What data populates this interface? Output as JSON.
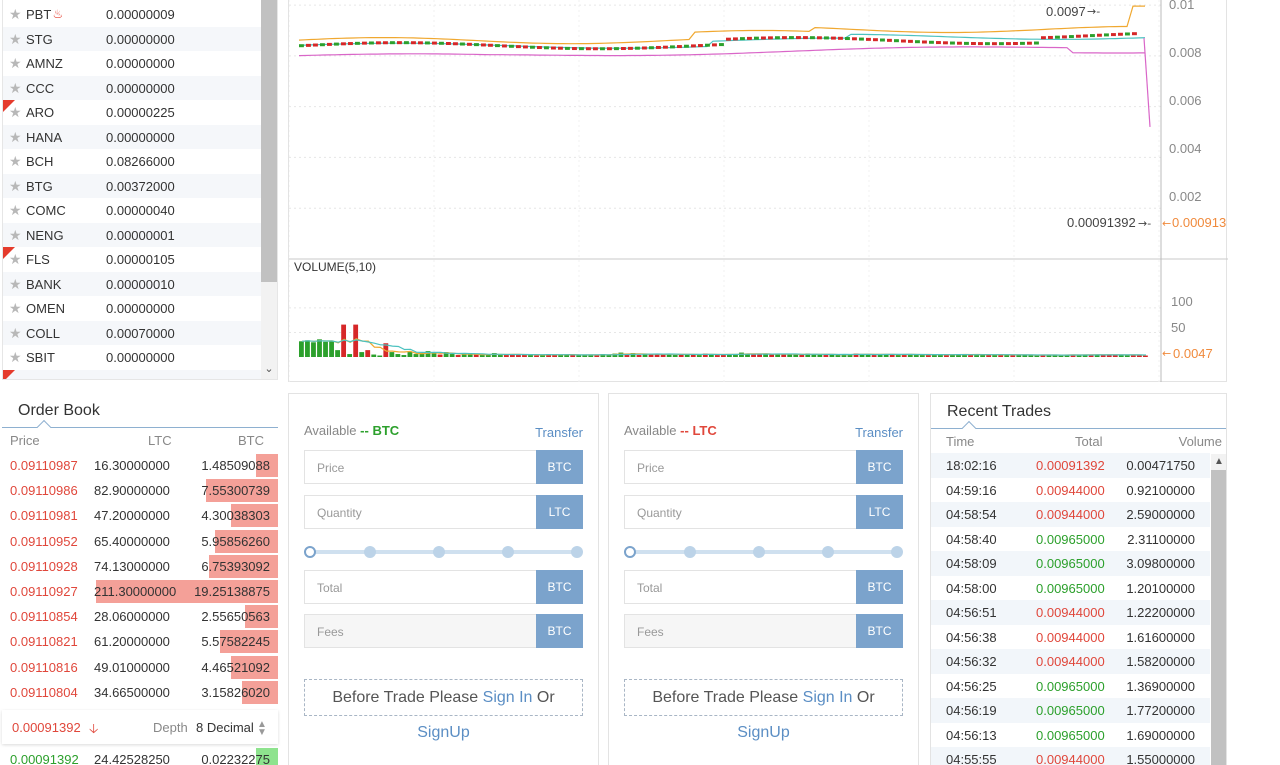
{
  "market": {
    "rows": [
      {
        "symbol": "PBT",
        "price": "0.00000009",
        "hot": true,
        "is_new": false
      },
      {
        "symbol": "STG",
        "price": "0.00000000",
        "hot": false,
        "is_new": false
      },
      {
        "symbol": "AMNZ",
        "price": "0.00000000",
        "hot": false,
        "is_new": false
      },
      {
        "symbol": "CCC",
        "price": "0.00000000",
        "hot": false,
        "is_new": false
      },
      {
        "symbol": "ARO",
        "price": "0.00000225",
        "hot": false,
        "is_new": true
      },
      {
        "symbol": "HANA",
        "price": "0.00000000",
        "hot": false,
        "is_new": false
      },
      {
        "symbol": "BCH",
        "price": "0.08266000",
        "hot": false,
        "is_new": false
      },
      {
        "symbol": "BTG",
        "price": "0.00372000",
        "hot": false,
        "is_new": false
      },
      {
        "symbol": "COMC",
        "price": "0.00000040",
        "hot": false,
        "is_new": false
      },
      {
        "symbol": "NENG",
        "price": "0.00000001",
        "hot": false,
        "is_new": false
      },
      {
        "symbol": "FLS",
        "price": "0.00000105",
        "hot": false,
        "is_new": true
      },
      {
        "symbol": "BANK",
        "price": "0.00000010",
        "hot": false,
        "is_new": false
      },
      {
        "symbol": "OMEN",
        "price": "0.00000000",
        "hot": false,
        "is_new": false
      },
      {
        "symbol": "COLL",
        "price": "0.00070000",
        "hot": false,
        "is_new": false
      },
      {
        "symbol": "SBIT",
        "price": "0.00000000",
        "hot": false,
        "is_new": false
      },
      {
        "symbol": "",
        "price": "",
        "hot": false,
        "is_new": true
      }
    ]
  },
  "chart": {
    "price_axis": [
      "0.01",
      "0.008",
      "0.006",
      "0.004",
      "0.002"
    ],
    "price_ylim": [
      0,
      0.0102
    ],
    "high_marker": "0.0097",
    "last_price_label": "0.00091392",
    "last_price_axis": "0.000913",
    "volume_title": "VOLUME(5,10)",
    "volume_axis": [
      "100",
      "50"
    ],
    "volume_ylim": [
      0,
      165
    ],
    "volume_last_axis": "0.0047",
    "colors": {
      "up": "#2ca02c",
      "down": "#d62728",
      "ma_orange": "#f0a830",
      "ma_teal": "#4cc2c0",
      "ma_pink": "#d966c8",
      "axis_orange": "#f08a3c"
    },
    "volumes": [
      32,
      34,
      30,
      36,
      31,
      33,
      14,
      66,
      6,
      66,
      10,
      14,
      5,
      3,
      28,
      10,
      6,
      4,
      10,
      6,
      8,
      12,
      7,
      5,
      10,
      6,
      4,
      5,
      6,
      5,
      4,
      4,
      8,
      4,
      5,
      6,
      4,
      5,
      4,
      3,
      4,
      6,
      5,
      4,
      5,
      4,
      3,
      4,
      5,
      4,
      6,
      4,
      7,
      9,
      5,
      8,
      4,
      5,
      7,
      6,
      5,
      6,
      4,
      5,
      6,
      5,
      4,
      7,
      5,
      4,
      5,
      6,
      5,
      9,
      7,
      5,
      6,
      7,
      5,
      6,
      5,
      6,
      5,
      4,
      7,
      6,
      5,
      4,
      5,
      4,
      6,
      5,
      7,
      5,
      6,
      4,
      5,
      6,
      5,
      4,
      5,
      6,
      5,
      4,
      5,
      4,
      5,
      4,
      5,
      6,
      5,
      4,
      5,
      4,
      5,
      4,
      5,
      4,
      3,
      5,
      4,
      4,
      3,
      4,
      5,
      4,
      3,
      4,
      5,
      4,
      5,
      4,
      5,
      4,
      5,
      4,
      3,
      4,
      5,
      4,
      3
    ],
    "volume_up": [
      1,
      1,
      1,
      1,
      1,
      1,
      1,
      0,
      1,
      0,
      1,
      0,
      1,
      1,
      0,
      1,
      1,
      1,
      1,
      1,
      1,
      1,
      1,
      0,
      1,
      1,
      0,
      1,
      1,
      0,
      1,
      1,
      1,
      1,
      0,
      0,
      0,
      0,
      1,
      0,
      1,
      0,
      0,
      1,
      1,
      0,
      1,
      1,
      1,
      0,
      1,
      1,
      1,
      1,
      0,
      1,
      0,
      1,
      0,
      0,
      0,
      1,
      1,
      0,
      1,
      0,
      1,
      0,
      1,
      0,
      0,
      1,
      1,
      1,
      1,
      0,
      0,
      1,
      0,
      1,
      0,
      1,
      1,
      0,
      1,
      1,
      1,
      0,
      1,
      1,
      1,
      1,
      0,
      1,
      1,
      0,
      1,
      1,
      0,
      1,
      0,
      1,
      1,
      1,
      0,
      1,
      1,
      0,
      1,
      1,
      1,
      0,
      1,
      1,
      0,
      1,
      0,
      1,
      0,
      1,
      1,
      1,
      1,
      0,
      1,
      1,
      1,
      1,
      0,
      1,
      1,
      0,
      1,
      0,
      0,
      0,
      1,
      1,
      0,
      0
    ]
  },
  "orderbook": {
    "title": "Order Book",
    "col_price": "Price",
    "col_qty": "LTC",
    "col_total": "BTC",
    "asks": [
      {
        "price": "0.09110987",
        "qty": "16.30000000",
        "total": "1.48509088",
        "depth": 0.08
      },
      {
        "price": "0.09110986",
        "qty": "82.90000000",
        "total": "7.55300739",
        "depth": 0.26
      },
      {
        "price": "0.09110981",
        "qty": "47.20000000",
        "total": "4.30038303",
        "depth": 0.17
      },
      {
        "price": "0.09110952",
        "qty": "65.40000000",
        "total": "5.95856260",
        "depth": 0.23
      },
      {
        "price": "0.09110928",
        "qty": "74.13000000",
        "total": "6.75393092",
        "depth": 0.25
      },
      {
        "price": "0.09110927",
        "qty": "211.30000000",
        "total": "19.25138875",
        "depth": 0.66
      },
      {
        "price": "0.09110854",
        "qty": "28.06000000",
        "total": "2.55650563",
        "depth": 0.12
      },
      {
        "price": "0.09110821",
        "qty": "61.20000000",
        "total": "5.57582245",
        "depth": 0.21
      },
      {
        "price": "0.09110816",
        "qty": "49.01000000",
        "total": "4.46521092",
        "depth": 0.17
      },
      {
        "price": "0.09110804",
        "qty": "34.66500000",
        "total": "3.15826020",
        "depth": 0.13
      }
    ],
    "last_price": "0.00091392",
    "depth_label": "Depth",
    "decimal_select": "8 Decimal",
    "bid": {
      "price": "0.00091392",
      "qty": "24.42528250",
      "total": "0.02232275",
      "depth": 0.08
    }
  },
  "buy_form": {
    "available_label": "Available",
    "available_sep": "--",
    "available_currency": "BTC",
    "transfer": "Transfer",
    "price_placeholder": "Price",
    "price_unit": "BTC",
    "qty_placeholder": "Quantity",
    "qty_unit": "LTC",
    "total_placeholder": "Total",
    "total_unit": "BTC",
    "fees_placeholder": "Fees",
    "fees_unit": "BTC",
    "notice_prefix": "Before Trade Please",
    "sign_in": "Sign In",
    "or": "Or",
    "sign_up": "SignUp"
  },
  "sell_form": {
    "available_label": "Available",
    "available_sep": "--",
    "available_currency": "LTC",
    "transfer": "Transfer",
    "price_placeholder": "Price",
    "price_unit": "BTC",
    "qty_placeholder": "Quantity",
    "qty_unit": "LTC",
    "total_placeholder": "Total",
    "total_unit": "BTC",
    "fees_placeholder": "Fees",
    "fees_unit": "BTC",
    "notice_prefix": "Before Trade Please",
    "sign_in": "Sign In",
    "or": "Or",
    "sign_up": "SignUp"
  },
  "trades": {
    "title": "Recent Trades",
    "col_time": "Time",
    "col_total": "Total",
    "col_volume": "Volume",
    "rows": [
      {
        "time": "18:02:16",
        "price": "0.00091392",
        "volume": "0.00471750",
        "side": "sell"
      },
      {
        "time": "04:59:16",
        "price": "0.00944000",
        "volume": "0.92100000",
        "side": "sell"
      },
      {
        "time": "04:58:54",
        "price": "0.00944000",
        "volume": "2.59000000",
        "side": "sell"
      },
      {
        "time": "04:58:40",
        "price": "0.00965000",
        "volume": "2.31100000",
        "side": "buy"
      },
      {
        "time": "04:58:09",
        "price": "0.00965000",
        "volume": "3.09800000",
        "side": "buy"
      },
      {
        "time": "04:58:00",
        "price": "0.00965000",
        "volume": "1.20100000",
        "side": "buy"
      },
      {
        "time": "04:56:51",
        "price": "0.00944000",
        "volume": "1.22200000",
        "side": "sell"
      },
      {
        "time": "04:56:38",
        "price": "0.00944000",
        "volume": "1.61600000",
        "side": "sell"
      },
      {
        "time": "04:56:32",
        "price": "0.00944000",
        "volume": "1.58200000",
        "side": "sell"
      },
      {
        "time": "04:56:25",
        "price": "0.00965000",
        "volume": "1.36900000",
        "side": "buy"
      },
      {
        "time": "04:56:19",
        "price": "0.00965000",
        "volume": "1.77200000",
        "side": "buy"
      },
      {
        "time": "04:56:13",
        "price": "0.00965000",
        "volume": "1.69000000",
        "side": "buy"
      },
      {
        "time": "04:55:55",
        "price": "0.00944000",
        "volume": "1.55000000",
        "side": "sell"
      }
    ]
  }
}
